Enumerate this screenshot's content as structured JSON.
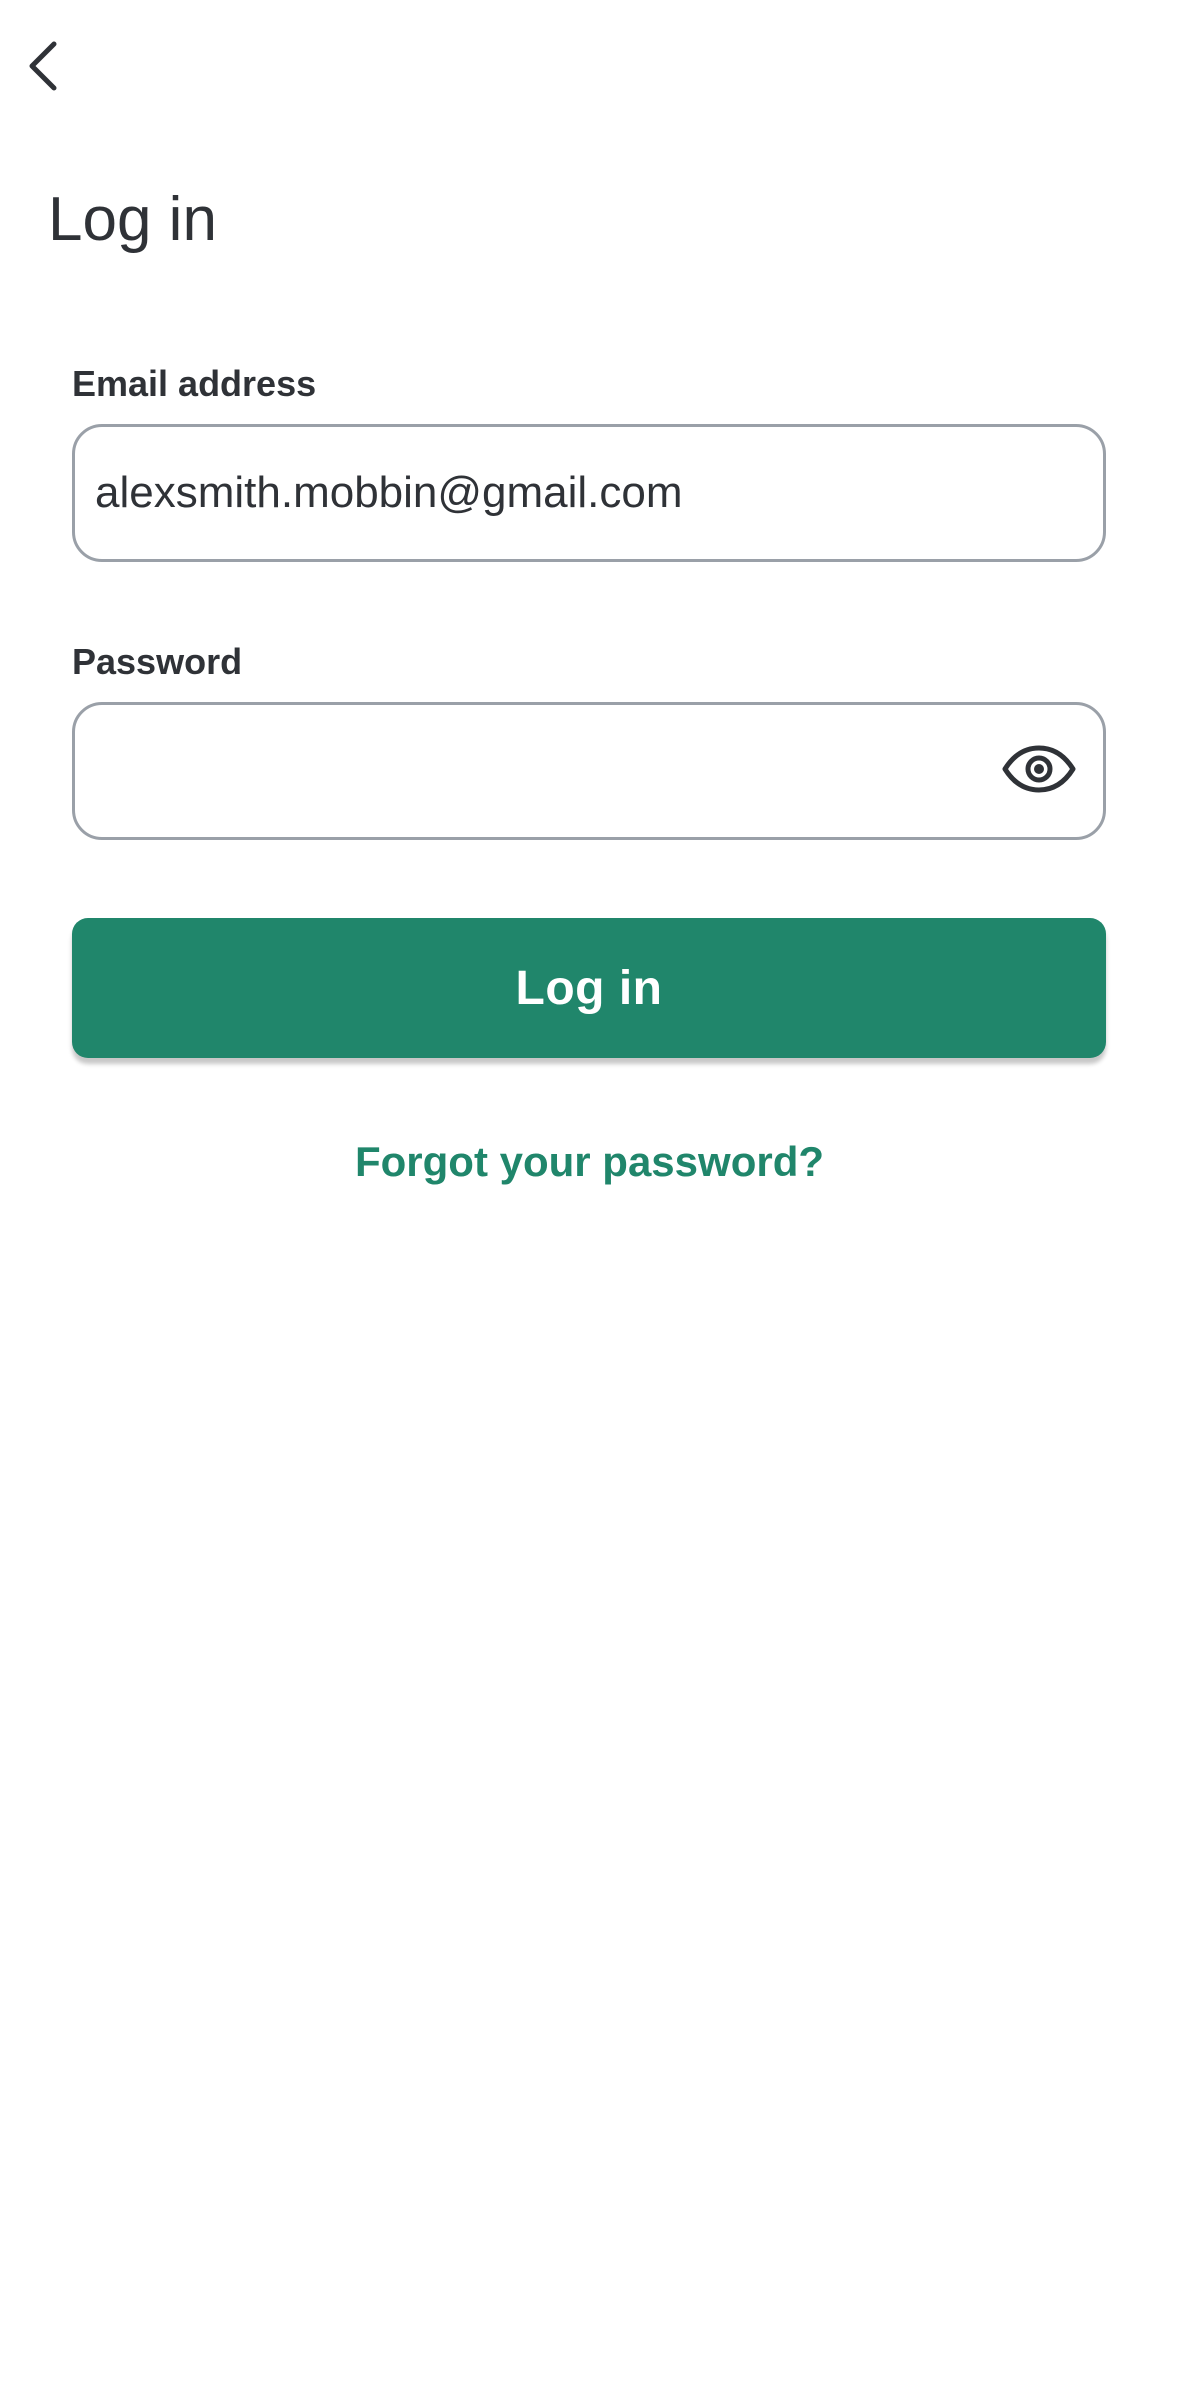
{
  "header": {
    "back_icon": "chevron-left-icon",
    "title": "Log in"
  },
  "form": {
    "email": {
      "label": "Email address",
      "value": "alexsmith.mobbin@gmail.com"
    },
    "password": {
      "label": "Password",
      "value": "",
      "toggle_icon": "eye-icon"
    },
    "submit_label": "Log in",
    "forgot_link": "Forgot your password?"
  },
  "colors": {
    "accent": "#20866b",
    "text": "#2f3237",
    "field_border": "#9aa0a8"
  }
}
